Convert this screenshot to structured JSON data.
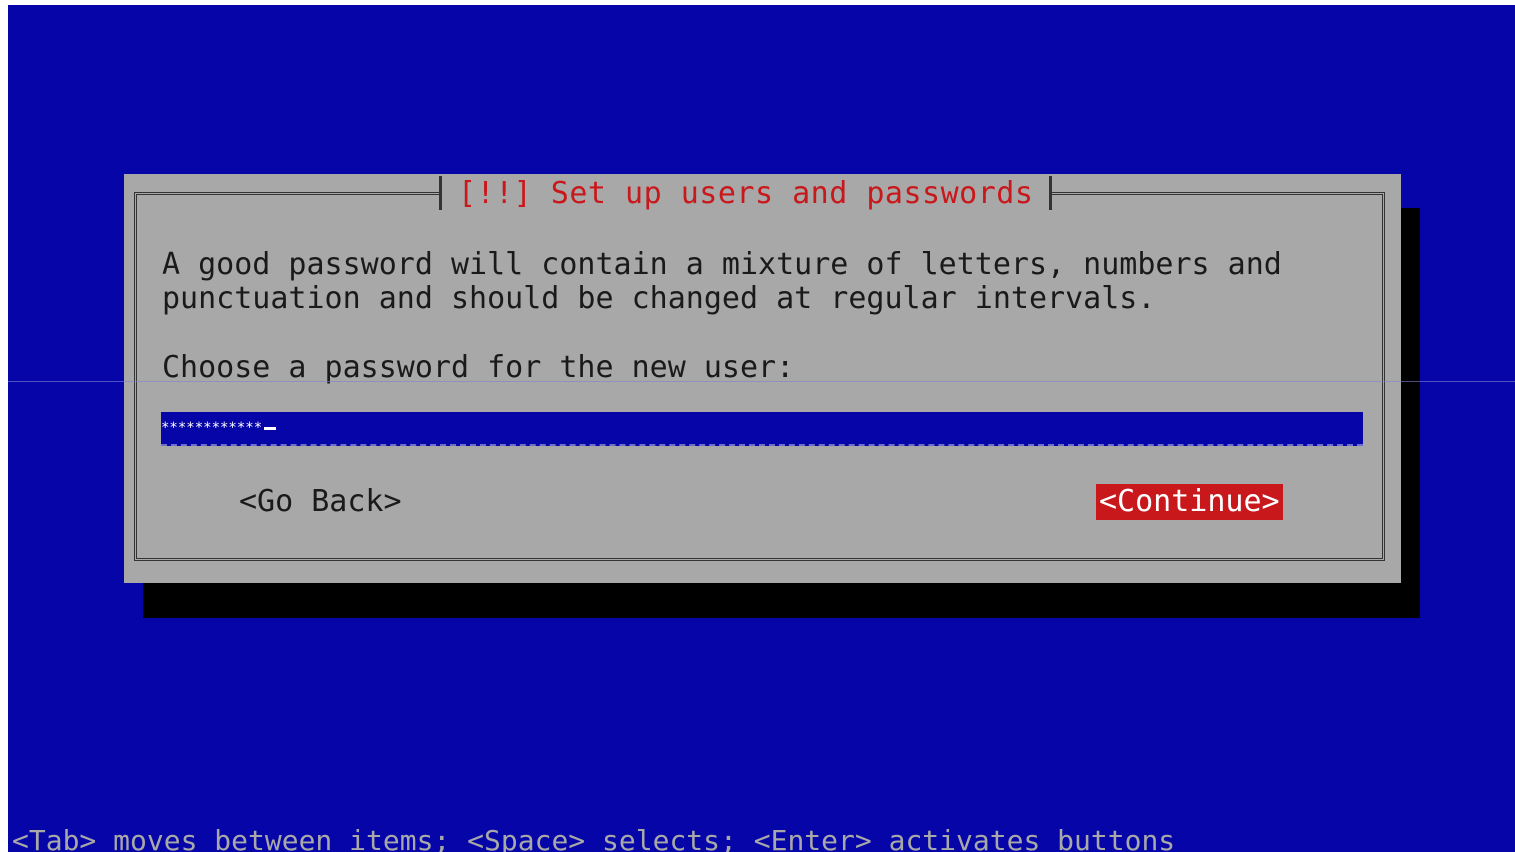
{
  "dialog": {
    "title": "[!!] Set up users and passwords",
    "description_line1": "A good password will contain a mixture of letters, numbers and",
    "description_line2": "punctuation and should be changed at regular intervals.",
    "prompt": "Choose a password for the new user:",
    "password_masked": "************",
    "buttons": {
      "go_back": "<Go Back>",
      "continue": "<Continue>"
    }
  },
  "help_line": "<Tab> moves between items; <Space> selects; <Enter> activates buttons",
  "colors": {
    "background": "#0505a8",
    "dialog": "#a8a8a8",
    "title": "#c8181c",
    "selected_button": "#c8181c",
    "shadow": "#000000"
  }
}
